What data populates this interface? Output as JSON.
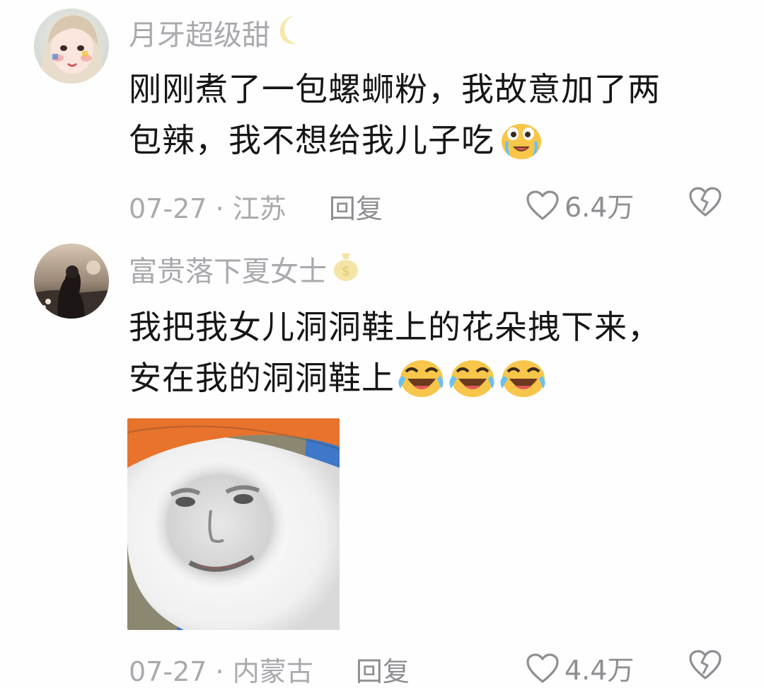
{
  "comments": [
    {
      "username": "月牙超级甜",
      "badge_icon": "crescent-moon-icon",
      "lines": [
        "刚刚煮了一包螺蛳粉，我故意加了两",
        "包辣，我不想给我儿子吃"
      ],
      "inline_emojis": [
        "crying-face-emoji"
      ],
      "date": "07-27",
      "separator": "·",
      "location": "江苏",
      "reply_label": "回复",
      "likes": "6.4万"
    },
    {
      "username": "富贵落下夏女士",
      "badge_icon": "money-bag-icon",
      "lines": [
        "我把我女儿洞洞鞋上的花朵拽下来，",
        "安在我的洞洞鞋上"
      ],
      "inline_emojis": [
        "laughing-crying-emoji",
        "laughing-crying-emoji",
        "laughing-crying-emoji"
      ],
      "sticker": "meme-face-sticker",
      "date": "07-27",
      "separator": "·",
      "location": "内蒙古",
      "reply_label": "回复",
      "likes": "4.4万"
    }
  ],
  "colors": {
    "username": "#a9a9ae",
    "text": "#161616",
    "meta": "#a9a9ae",
    "icon": "#8e8e93"
  }
}
